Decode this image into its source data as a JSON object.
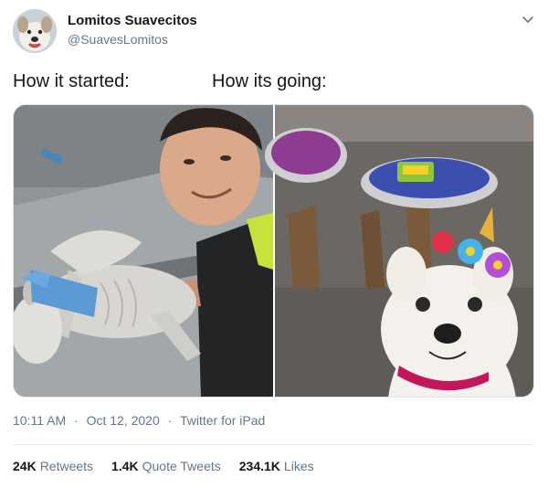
{
  "tweet": {
    "display_name": "Lomitos Suavecitos",
    "handle": "@SuavesLomitos",
    "caption_left": "How it started:",
    "caption_right": "How its going:",
    "time": "10:11 AM",
    "date": "Oct 12, 2020",
    "source": "Twitter for iPad",
    "separator": "·"
  },
  "stats": {
    "retweets_count": "24K",
    "retweets_label": "Retweets",
    "quotes_count": "1.4K",
    "quotes_label": "Quote Tweets",
    "likes_count": "234.1K",
    "likes_label": "Likes"
  },
  "icons": {
    "menu": "chevron-down-icon"
  },
  "colors": {
    "secondary_text": "#657786",
    "primary_text": "#14171a",
    "divider": "#e6ecf0"
  }
}
